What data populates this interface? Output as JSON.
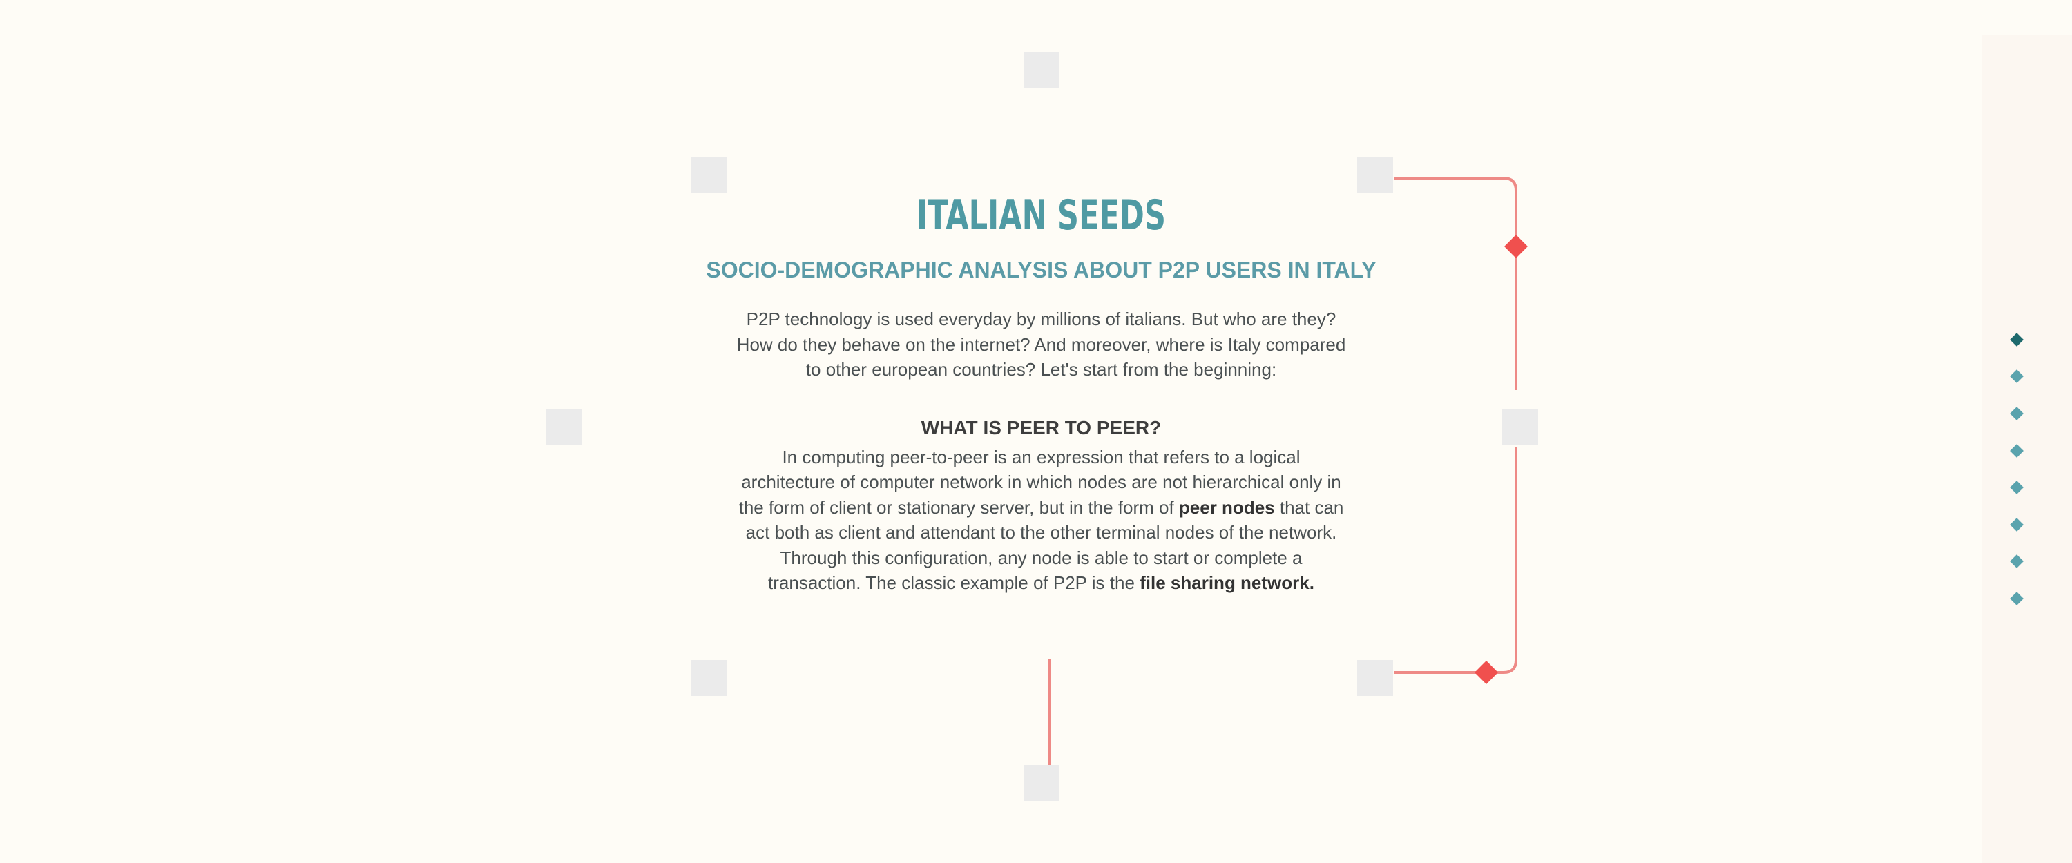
{
  "intro": {
    "title": "ITALIAN SEEDS",
    "subtitle": "SOCIO-DEMOGRAPHIC ANALYSIS ABOUT P2P USERS IN ITALY",
    "paragraph": "P2P technology is used everyday by millions of italians. But who are they? How do they behave on the internet? And moreover, where is Italy compared to other european countries? Let's start from the beginning:"
  },
  "section": {
    "heading": "WHAT IS PEER TO PEER?",
    "text_1": "In computing peer-to-peer is an expression that refers to a logical architecture of computer network in which nodes are not hierarchical only in the form of client or stationary server, but in the form of ",
    "bold_1": "peer nodes",
    "text_2": " that can act both as client and attendant to the other terminal nodes of the network. Through this configuration, any node is able to start or complete a transaction. The classic example of P2P is the ",
    "bold_2": "file sharing network."
  },
  "side_nav": {
    "item_count": 8,
    "active_index": 0,
    "icon": "diamond-icon"
  },
  "colors": {
    "background": "#fefcf6",
    "accent_teal": "#4f9aa3",
    "nav_active": "#1e6a6d",
    "nav_inactive": "#5aa3ad",
    "link_red": "#ee8a86",
    "diamond_red": "#f0504e",
    "node_gray": "#ebebeb"
  }
}
